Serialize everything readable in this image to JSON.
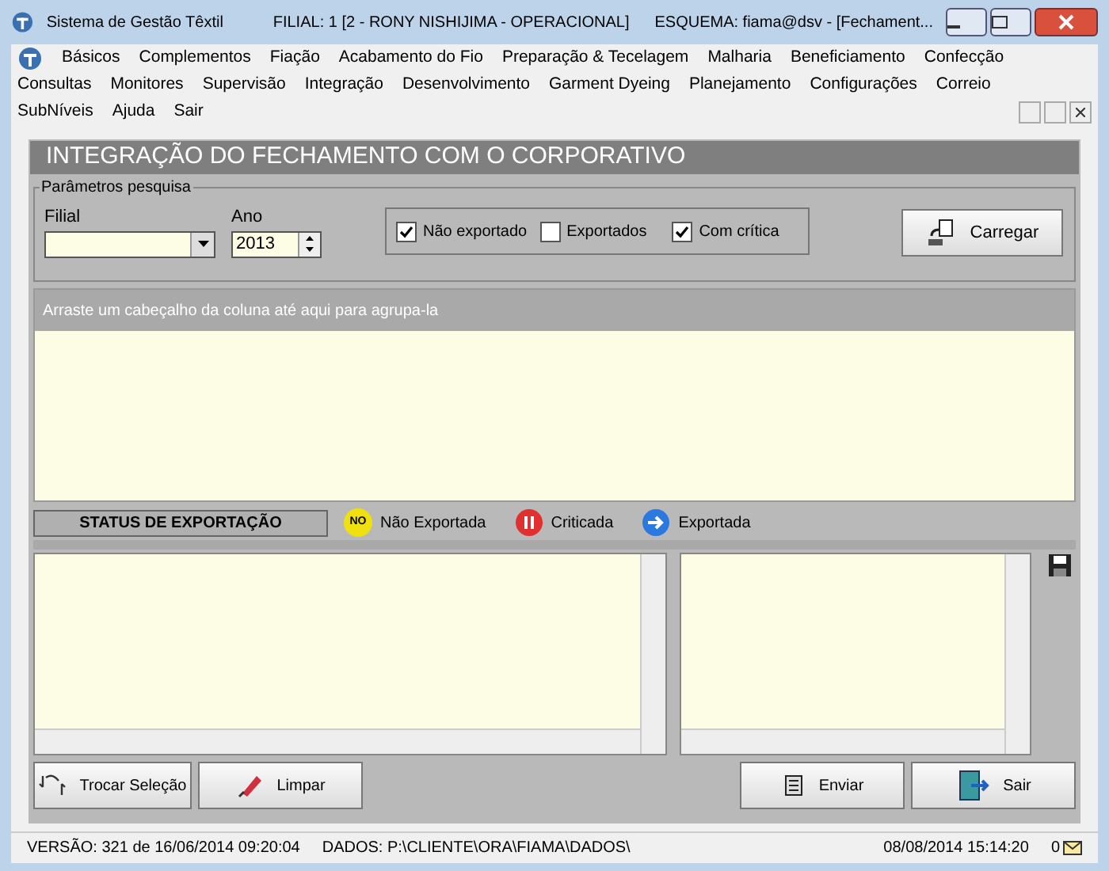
{
  "window": {
    "title": "Sistema de Gestão Têxtil",
    "filial": "FILIAL: 1 [2 - RONY NISHIJIMA - OPERACIONAL]",
    "esquema": "ESQUEMA: fiama@dsv - [Fechament..."
  },
  "menu": [
    [
      "Básicos",
      "Complementos",
      "Fiação",
      "Acabamento do Fio",
      "Preparação & Tecelagem",
      "Malharia",
      "Beneficiamento",
      "Confecção"
    ],
    [
      "Consultas",
      "Monitores",
      "Supervisão",
      "Integração",
      "Desenvolvimento",
      "Garment Dyeing",
      "Planejamento",
      "Configurações",
      "Correio"
    ],
    [
      "SubNíveis",
      "Ajuda",
      "Sair"
    ]
  ],
  "form": {
    "title": "INTEGRAÇÃO DO FECHAMENTO COM O CORPORATIVO",
    "legend": "Parâmetros pesquisa",
    "filial_label": "Filial",
    "ano_label": "Ano",
    "ano_value": "2013",
    "checkboxes": [
      {
        "label": "Não exportado",
        "checked": true
      },
      {
        "label": "Exportados",
        "checked": false
      },
      {
        "label": "Com crítica",
        "checked": true
      }
    ],
    "load_button": "Carregar"
  },
  "grid": {
    "group_hint": "Arraste um cabeçalho da coluna até aqui para agrupa-la"
  },
  "legend": {
    "title": "STATUS DE EXPORTAÇÃO",
    "items": [
      {
        "kind": "no",
        "badge": "NO",
        "label": "Não Exportada"
      },
      {
        "kind": "pause",
        "label": "Criticada"
      },
      {
        "kind": "arrow",
        "label": "Exportada"
      }
    ]
  },
  "buttons_left": [
    {
      "kind": "swap",
      "label": "Trocar Seleção"
    },
    {
      "kind": "eraser",
      "label": "Limpar"
    }
  ],
  "buttons_right": [
    {
      "kind": "send",
      "label": "Enviar"
    },
    {
      "kind": "exit",
      "label": "Sair"
    }
  ],
  "status_bar": {
    "version": "VERSÃO: 321 de 16/06/2014 09:20:04",
    "data": "DADOS: P:\\CLIENTE\\ORA\\FIAMA\\DADOS\\",
    "datetime": "08/08/2014 15:14:20",
    "count": "0"
  }
}
